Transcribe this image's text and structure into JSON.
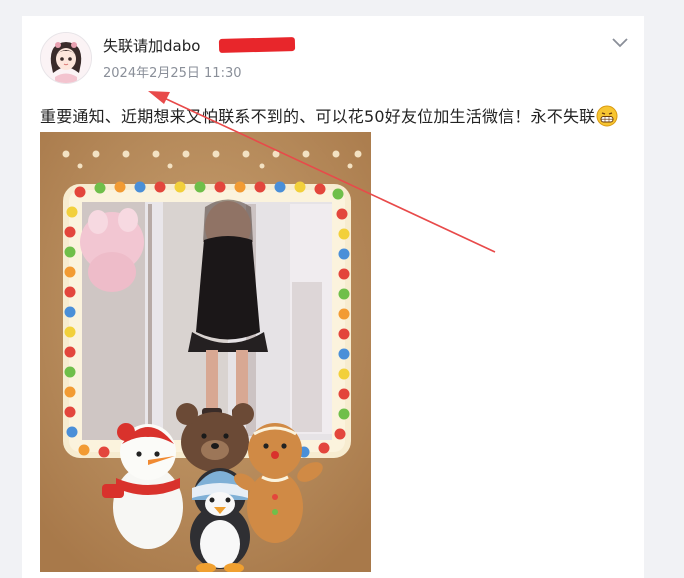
{
  "post": {
    "username": "失联请加dabo",
    "timestamp": "2024年2月25日 11:30",
    "text": "重要通知、近期想来又怕联系不到的、可以花50好友位加生活微信！永不失联"
  },
  "icons": {
    "more": "chevron-down-icon",
    "emoji": "grinning-face-icon"
  },
  "colors": {
    "redaction": "#e8262b",
    "timestamp": "#8a8f99",
    "accent": "#e84a4a"
  }
}
